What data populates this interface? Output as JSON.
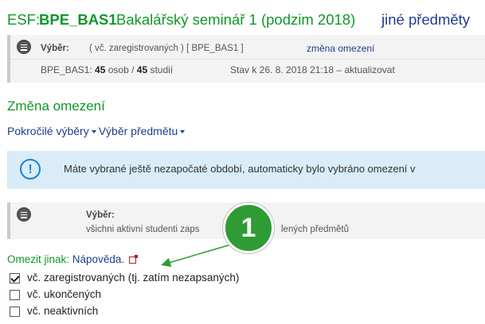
{
  "course": {
    "faculty_prefix": "ESF:",
    "code": "BPE_BAS1",
    "name": "Bakalářský seminář 1 (podzim 2018)",
    "other_subjects_link": "jiné předměty"
  },
  "selection_panel": {
    "label": "Výběr:",
    "filter_text": "( vč. zaregistrovaných ) [ BPE_BAS1 ]",
    "change_link": "změna omezení",
    "count_prefix": "BPE_BAS1: ",
    "persons": "45",
    "persons_word": " osob / ",
    "studies": "45",
    "studies_word": " studií",
    "status": "Stav k 26. 8. 2018 21:18 – aktualizovat"
  },
  "section": {
    "title": "Změna omezení",
    "menu": [
      {
        "label": "Pokročilé výběry"
      },
      {
        "label": "Výběr předmětu"
      }
    ]
  },
  "alert": {
    "message": "Máte vybrané ještě nezapočaté období, automaticky bylo vybráno omezení v"
  },
  "selection_box": {
    "label": "Výběr:",
    "text": "všichni aktivní studenti zapsaných nebo zaregistrovaných do vybraných předmětů",
    "visible_text": "všichni aktivní studenti zaps",
    "visible_text_tail": "lených předmětů"
  },
  "restrict": {
    "label": "Omezit jinak:",
    "help_link": "Nápověda."
  },
  "checkboxes": [
    {
      "label": "vč. zaregistrovaných (tj. zatím nezapsaných)",
      "checked": true
    },
    {
      "label": "vč. ukončených",
      "checked": false
    },
    {
      "label": "vč. neaktivních",
      "checked": false
    }
  ],
  "annotation": {
    "number": "1",
    "color": "#2e9b35"
  }
}
